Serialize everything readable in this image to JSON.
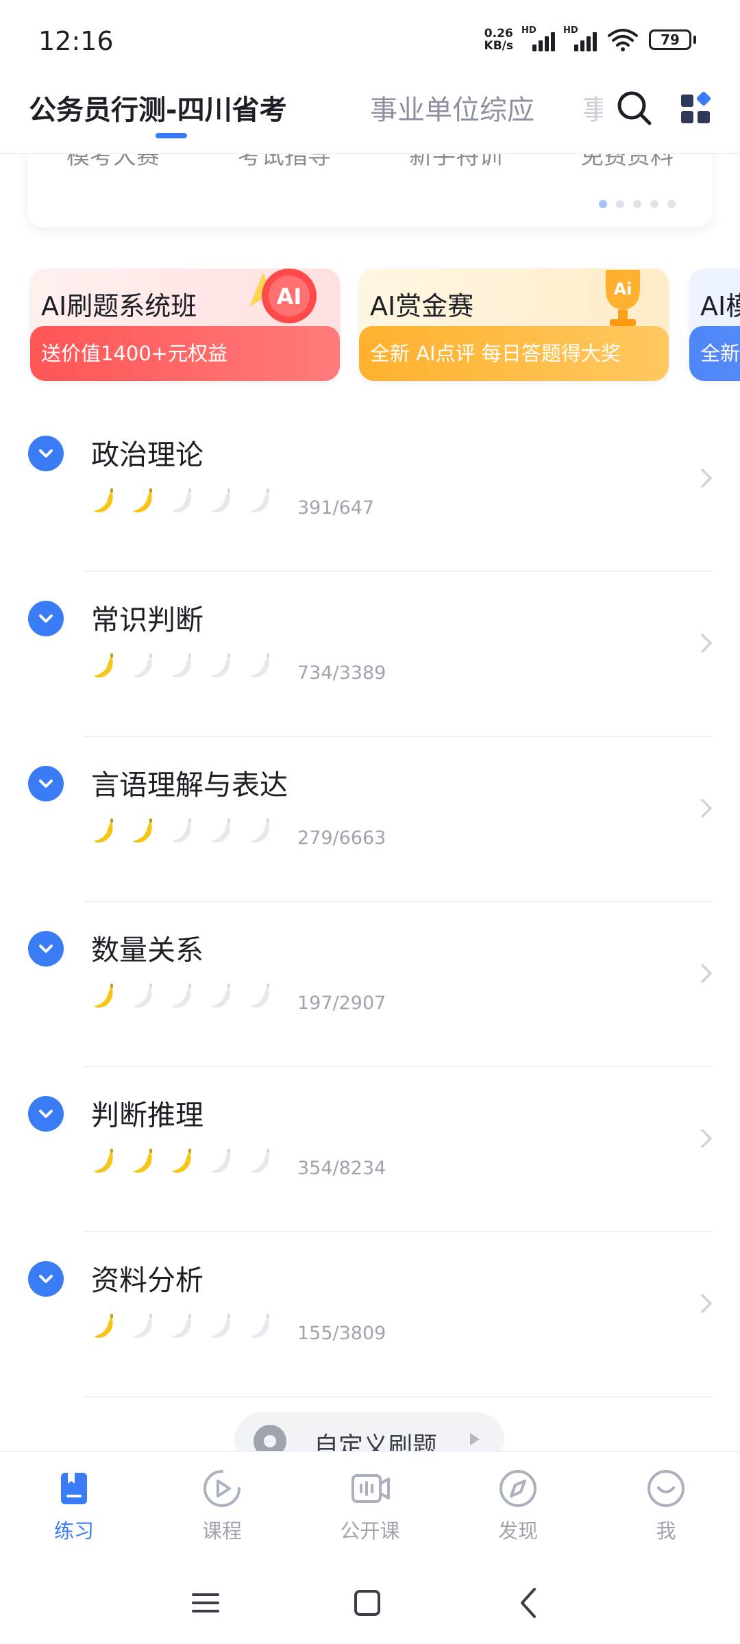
{
  "status_bar": {
    "time": "12:16",
    "net_speed_value": "0.26",
    "net_speed_unit": "KB/s",
    "signal_1_label": "HD",
    "signal_2_label": "HD",
    "battery": "79"
  },
  "top_tabs": {
    "items": [
      "公务员行测-四川省考",
      "事业单位综应",
      "事"
    ],
    "active_index": 0
  },
  "banner": {
    "links": [
      "模考大赛",
      "考试指导",
      "新手特训",
      "免费资料"
    ],
    "page_count": 5,
    "active_page": 0
  },
  "promos": [
    {
      "title": "AI刷题系统班",
      "subtitle": "送价值1400+元权益",
      "color": "#ff5a5a"
    },
    {
      "title": "AI赏金赛",
      "subtitle": "全新 AI点评 每日答题得大奖",
      "color": "#ffb12e"
    },
    {
      "title": "AI模",
      "subtitle": "全新",
      "color": "#4f86f7"
    }
  ],
  "subjects": [
    {
      "name": "政治理论",
      "level": 2,
      "max_level": 5,
      "progress": "391/647"
    },
    {
      "name": "常识判断",
      "level": 1,
      "max_level": 5,
      "progress": "734/3389"
    },
    {
      "name": "言语理解与表达",
      "level": 2,
      "max_level": 5,
      "progress": "279/6663"
    },
    {
      "name": "数量关系",
      "level": 1,
      "max_level": 5,
      "progress": "197/2907"
    },
    {
      "name": "判断推理",
      "level": 3,
      "max_level": 5,
      "progress": "354/8234"
    },
    {
      "name": "资料分析",
      "level": 1,
      "max_level": 5,
      "progress": "155/3809"
    }
  ],
  "custom_practice": {
    "label": "自定义刷题"
  },
  "bottom_nav": {
    "items": [
      {
        "label": "练习",
        "icon": "practice-book-icon",
        "active": true
      },
      {
        "label": "课程",
        "icon": "course-play-icon",
        "active": false
      },
      {
        "label": "公开课",
        "icon": "live-class-icon",
        "active": false
      },
      {
        "label": "发现",
        "icon": "compass-icon",
        "active": false
      },
      {
        "label": "我",
        "icon": "profile-icon",
        "active": false
      }
    ]
  },
  "colors": {
    "accent": "#3a7cf6",
    "banana_on": "#f5c518",
    "banana_off": "#e6e8ee"
  }
}
